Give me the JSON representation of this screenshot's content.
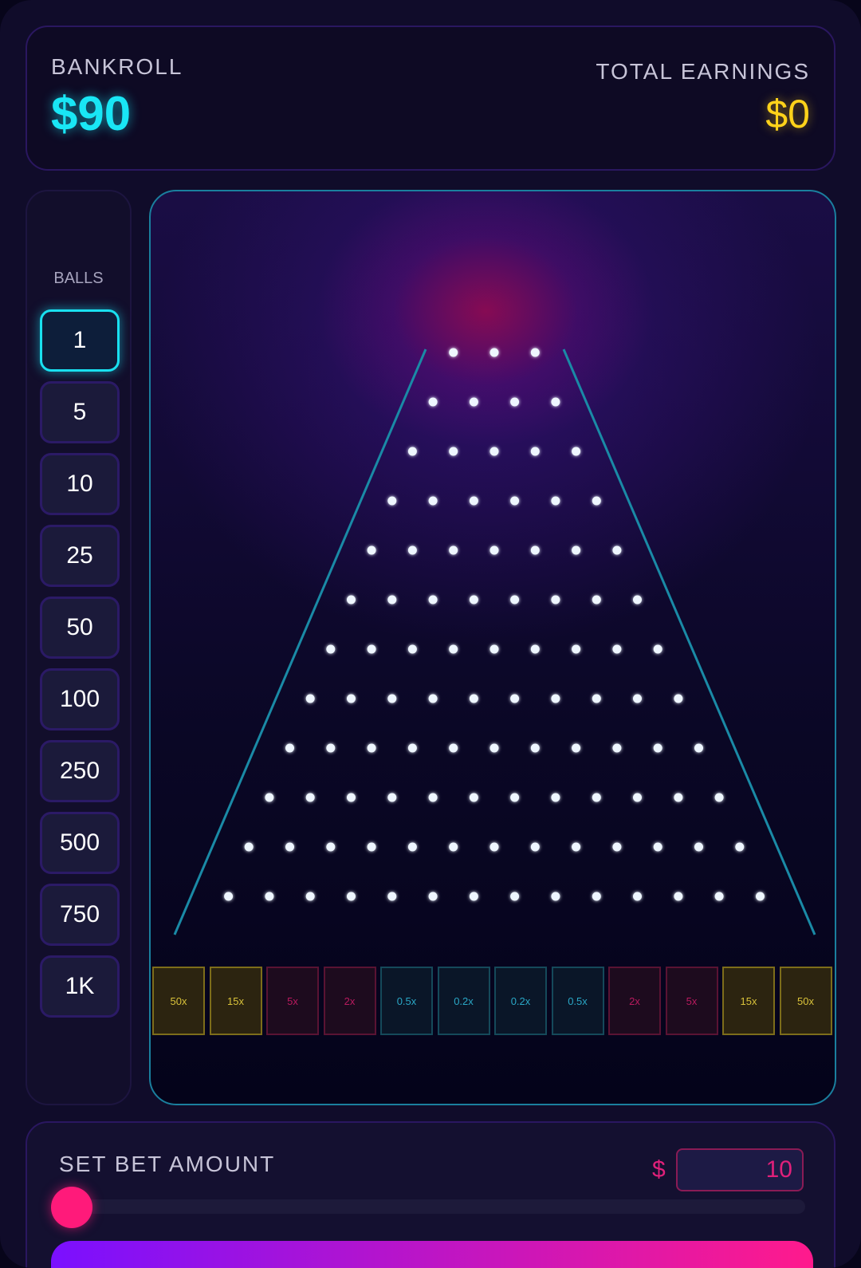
{
  "header": {
    "bankroll_label": "BANKROLL",
    "bankroll_value": "$90",
    "earnings_label": "TOTAL EARNINGS",
    "earnings_value": "$0"
  },
  "balls": {
    "title": "BALLS",
    "options": [
      "1",
      "5",
      "10",
      "25",
      "50",
      "100",
      "250",
      "500",
      "750",
      "1K"
    ],
    "selected": "1"
  },
  "board": {
    "peg_rows": [
      3,
      4,
      5,
      6,
      7,
      8,
      9,
      10,
      11,
      12,
      13,
      14
    ],
    "buckets": [
      {
        "label": "50x",
        "tier": "gold"
      },
      {
        "label": "15x",
        "tier": "gold"
      },
      {
        "label": "5x",
        "tier": "pink"
      },
      {
        "label": "2x",
        "tier": "pink"
      },
      {
        "label": "0.5x",
        "tier": "teal"
      },
      {
        "label": "0.2x",
        "tier": "teal"
      },
      {
        "label": "0.2x",
        "tier": "teal"
      },
      {
        "label": "0.5x",
        "tier": "teal"
      },
      {
        "label": "2x",
        "tier": "pink"
      },
      {
        "label": "5x",
        "tier": "pink"
      },
      {
        "label": "15x",
        "tier": "gold"
      },
      {
        "label": "50x",
        "tier": "gold"
      }
    ]
  },
  "bet": {
    "label": "SET BET AMOUNT",
    "currency": "$",
    "value": "10",
    "slider_fraction": 0.0
  },
  "colors": {
    "cyan": "#19e6f5",
    "gold": "#ffd21a",
    "pink": "#e0207a",
    "button_gradient_start": "#7a10ff",
    "button_gradient_end": "#ff1a8c"
  }
}
